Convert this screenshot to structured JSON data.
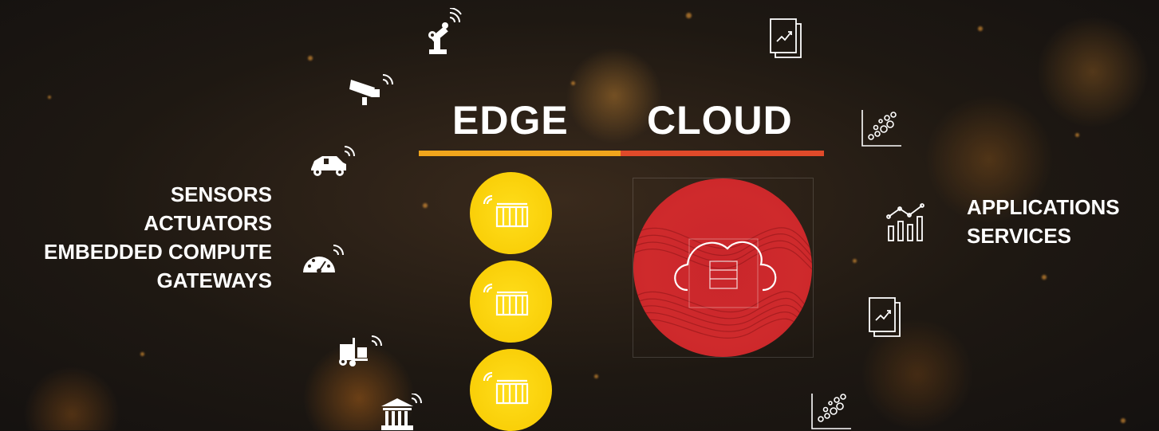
{
  "headings": {
    "edge": "EDGE",
    "cloud": "CLOUD"
  },
  "left_labels": [
    "SENSORS",
    "ACTUATORS",
    "EMBEDDED COMPUTE",
    "GATEWAYS"
  ],
  "right_labels": [
    "APPLICATIONS",
    "SERVICES"
  ],
  "colors": {
    "edge_bar": "#f0a51c",
    "cloud_bar": "#e04a2a",
    "edge_node": "#f7c900",
    "cloud_circle": "#cf2a2c"
  },
  "device_icons": [
    "robot-arm-icon",
    "security-camera-icon",
    "connected-car-icon",
    "gauge-icon",
    "forklift-icon",
    "bank-building-icon"
  ],
  "app_icons": [
    "report-chart-icon",
    "scatter-chart-icon",
    "bar-line-chart-icon",
    "report-chart-icon",
    "scatter-chart-icon"
  ]
}
